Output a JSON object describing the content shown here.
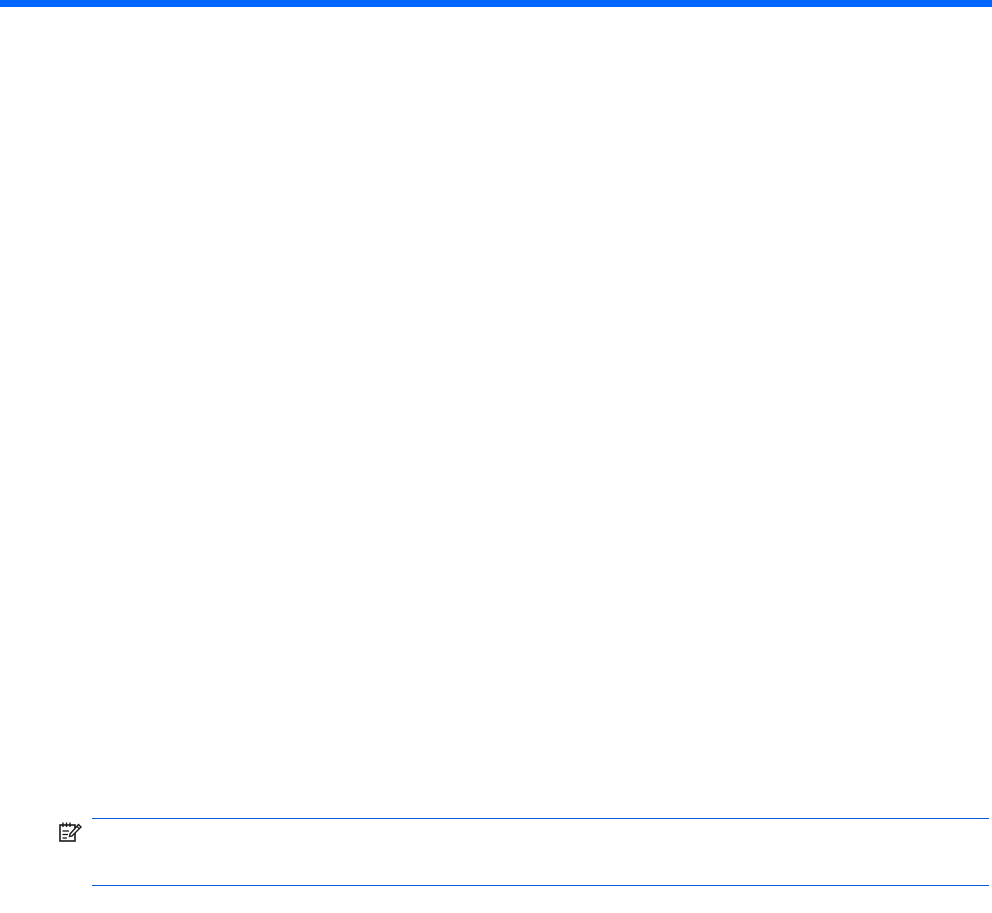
{
  "colors": {
    "accent_bar": "#0066ff",
    "note_rule": "#0a5cd6",
    "note_icon": "#1a1a1a",
    "background": "#ffffff"
  },
  "note": {
    "icon": "note-pencil-icon",
    "text": ""
  }
}
